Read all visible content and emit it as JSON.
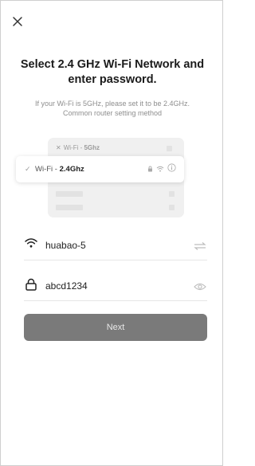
{
  "header": {
    "close_icon": "close-icon"
  },
  "title": "Select 2.4 GHz Wi-Fi Network and enter password.",
  "subtitle": "If your Wi-Fi is 5GHz, please set it to be 2.4GHz. Common router setting method",
  "illustration": {
    "row_5g_prefix": "Wi-Fi - ",
    "row_5g_band": "5Ghz",
    "row_24_prefix": "Wi-Fi - ",
    "row_24_band": "2.4Ghz",
    "icons": [
      "lock-icon",
      "wifi-icon",
      "info-icon"
    ]
  },
  "wifi_field": {
    "icon": "wifi-icon",
    "value": "huabao-5",
    "action_icon": "switch-network-icon"
  },
  "password_field": {
    "icon": "lock-icon",
    "value": "abcd1234",
    "action_icon": "eye-icon"
  },
  "next_button": {
    "label": "Next",
    "color": "#7a7a7a"
  }
}
